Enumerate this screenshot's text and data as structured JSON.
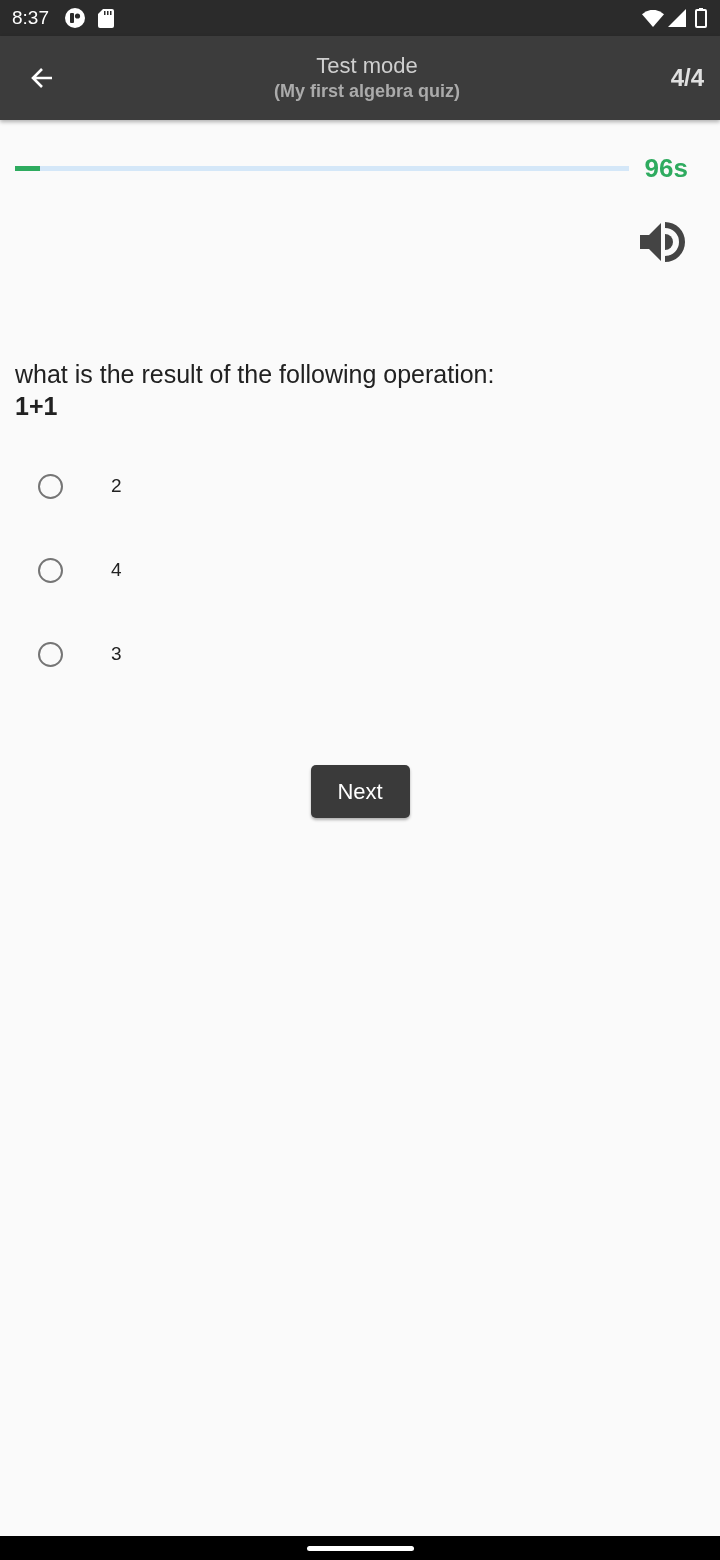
{
  "status_bar": {
    "time": "8:37"
  },
  "app_bar": {
    "title": "Test mode",
    "subtitle": "(My first algebra quiz)",
    "counter": "4/4"
  },
  "timer": {
    "level": 0.04,
    "reading": "96s"
  },
  "question": {
    "text": "what is the result of the following operation:",
    "expression": "1+1"
  },
  "options": [
    {
      "label": "2",
      "selected": false
    },
    {
      "label": "4",
      "selected": false
    },
    {
      "label": "3",
      "selected": false
    }
  ],
  "next_button": {
    "label": "Next"
  }
}
